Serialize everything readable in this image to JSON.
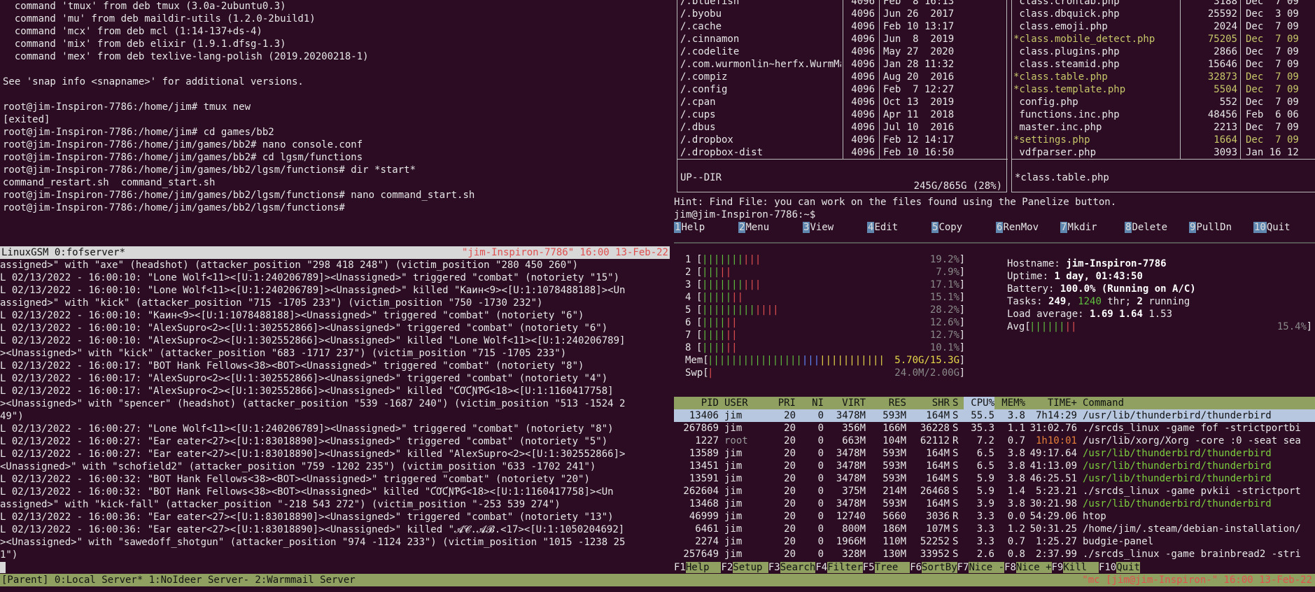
{
  "terminal_top_left": {
    "lines": [
      "  command 'tmux' from deb tmux (3.0a-2ubuntu0.3)",
      "  command 'mu' from deb maildir-utils (1.2.0-2build1)",
      "  command 'mcx' from deb mcl (1:14-137+ds-4)",
      "  command 'mix' from deb elixir (1.9.1.dfsg-1.3)",
      "  command 'mex' from deb texlive-lang-polish (2019.20200218-1)",
      "",
      "See 'snap info <snapname>' for additional versions.",
      "",
      "root@jim-Inspiron-7786:/home/jim# tmux new",
      "[exited]",
      "root@jim-Inspiron-7786:/home/jim# cd games/bb2",
      "root@jim-Inspiron-7786:/home/jim/games/bb2# nano console.conf",
      "root@jim-Inspiron-7786:/home/jim/games/bb2# cd lgsm/functions",
      "root@jim-Inspiron-7786:/home/jim/games/bb2/lgsm/functions# dir *start*",
      "command_restart.sh  command_start.sh",
      "root@jim-Inspiron-7786:/home/jim/games/bb2/lgsm/functions# nano command_start.sh",
      "root@jim-Inspiron-7786:/home/jim/games/bb2/lgsm/functions#"
    ]
  },
  "tmux_pane_status": {
    "left": "LinuxGSM 0:fofserver*",
    "right": "\"jim-Inspiron-7786\" 16:00 13-Feb-22"
  },
  "terminal_bottom_left": {
    "lines": [
      "assigned>\" with \"axe\" (headshot) (attacker_position \"298 418 248\") (victim_position \"280 450 260\")",
      "L 02/13/2022 - 16:00:10: \"Lone Wolf<11><[U:1:240206789]><Unassigned>\" triggered \"combat\" (notoriety \"15\")",
      "L 02/13/2022 - 16:00:10: \"Lone Wolf<11><[U:1:240206789]><Unassigned>\" killed \"Каин<9><[U:1:1078488188]><Un",
      "assigned>\" with \"kick\" (attacker_position \"715 -1705 233\") (victim_position \"750 -1730 232\")",
      "L 02/13/2022 - 16:00:10: \"Каин<9><[U:1:1078488188]><Unassigned>\" triggered \"combat\" (notoriety \"6\")",
      "L 02/13/2022 - 16:00:10: \"AlexSupro<2><[U:1:302552866]><Unassigned>\" triggered \"combat\" (notoriety \"6\")",
      "L 02/13/2022 - 16:00:10: \"AlexSupro<2><[U:1:302552866]><Unassigned>\" killed \"Lone Wolf<11><[U:1:240206789]",
      "><Unassigned>\" with \"kick\" (attacker_position \"683 -1717 237\") (victim_position \"715 -1705 233\")",
      "L 02/13/2022 - 16:00:17: \"BOT Hank Fellows<38><BOT><Unassigned>\" triggered \"combat\" (notoriety \"8\")",
      "L 02/13/2022 - 16:00:17: \"AlexSupro<2><[U:1:302552866]><Unassigned>\" triggered \"combat\" (notoriety \"4\")",
      "L 02/13/2022 - 16:00:17: \"AlexSupro<2><[U:1:302552866]><Unassigned>\" killed \"ƇƠƇƝƤƓ<18><[U:1:1160417758]",
      "><Unassigned>\" with \"spencer\" (headshot) (attacker_position \"539 -1687 240\") (victim_position \"513 -1524 2",
      "49\")",
      "L 02/13/2022 - 16:00:27: \"Lone Wolf<11><[U:1:240206789]><Unassigned>\" triggered \"combat\" (notoriety \"8\")",
      "L 02/13/2022 - 16:00:27: \"Ear eater<27><[U:1:83018890]><Unassigned>\" triggered \"combat\" (notoriety \"5\")",
      "L 02/13/2022 - 16:00:27: \"Ear eater<27><[U:1:83018890]><Unassigned>\" killed \"AlexSupro<2><[U:1:302552866]>",
      "<Unassigned>\" with \"schofield2\" (attacker_position \"759 -1202 235\") (victim_position \"633 -1702 241\")",
      "L 02/13/2022 - 16:00:32: \"BOT Hank Fellows<38><BOT><Unassigned>\" triggered \"combat\" (notoriety \"20\")",
      "L 02/13/2022 - 16:00:32: \"BOT Hank Fellows<38><BOT><Unassigned>\" killed \"ƇƠƇƝƤƓ<18><[U:1:1160417758]><Un",
      "assigned>\" with \"kick-fall\" (attacker_position \"-218 543 272\") (victim_position \"-253 539 274\")",
      "L 02/13/2022 - 16:00:36: \"Ear eater<27><[U:1:83018890]><Unassigned>\" triggered \"combat\" (notoriety \"13\")",
      "L 02/13/2022 - 16:00:36: \"Ear eater<27><[U:1:83018890]><Unassigned>\" killed \"𝓐𝓒.𝓐𝓑.<17><[U:1:1050204692]",
      "><Unassigned>\" with \"sawedoff_shotgun\" (attacker_position \"974 -1124 233\") (victim_position \"1015 -1238 25",
      "1\")"
    ]
  },
  "mc": {
    "left_panel": {
      "rows": [
        {
          "name": "/.bluefish",
          "size": "4096",
          "date": "Feb  8 16:13"
        },
        {
          "name": "/.byobu",
          "size": "4096",
          "date": "Jun 26  2017"
        },
        {
          "name": "/.cache",
          "size": "4096",
          "date": "Feb 10 13:17"
        },
        {
          "name": "/.cinnamon",
          "size": "4096",
          "date": "Jun  8  2019"
        },
        {
          "name": "/.codelite",
          "size": "4096",
          "date": "May 27  2020"
        },
        {
          "name": "/.com.wurmonlin~herfx.WurmMain",
          "size": "4096",
          "date": "Jan 28 11:32"
        },
        {
          "name": "/.compiz",
          "size": "4096",
          "date": "Aug 20  2016"
        },
        {
          "name": "/.config",
          "size": "4096",
          "date": "Feb  7 12:27"
        },
        {
          "name": "/.cpan",
          "size": "4096",
          "date": "Oct 13  2019"
        },
        {
          "name": "/.cups",
          "size": "4096",
          "date": "Apr 11  2018"
        },
        {
          "name": "/.dbus",
          "size": "4096",
          "date": "Jul 10  2016"
        },
        {
          "name": "/.dropbox",
          "size": "4096",
          "date": "Feb 12 14:17"
        },
        {
          "name": "/.dropbox-dist",
          "size": "4096",
          "date": "Feb 10 16:50"
        }
      ],
      "status": "UP--DIR",
      "disk": "245G/865G (28%)"
    },
    "right_panel": {
      "rows": [
        {
          "name": " class.crontab.php",
          "size": "3188",
          "date": "Dec  7 09",
          "hl": false
        },
        {
          "name": " class.dbquick.php",
          "size": "25592",
          "date": "Dec  3 09",
          "hl": false
        },
        {
          "name": " class.emoji.php",
          "size": "2024",
          "date": "Dec  7 09",
          "hl": false
        },
        {
          "name": "*class.mobile_detect.php",
          "size": "75205",
          "date": "Dec  7 09",
          "hl": true
        },
        {
          "name": " class.plugins.php",
          "size": "2866",
          "date": "Dec  7 09",
          "hl": false
        },
        {
          "name": " class.steamid.php",
          "size": "15646",
          "date": "Dec  7 09",
          "hl": false
        },
        {
          "name": "*class.table.php",
          "size": "32873",
          "date": "Dec  7 09",
          "hl": true
        },
        {
          "name": "*class.template.php",
          "size": "5504",
          "date": "Dec  7 09",
          "hl": true
        },
        {
          "name": " config.php",
          "size": "552",
          "date": "Dec  7 09",
          "hl": false
        },
        {
          "name": " functions.inc.php",
          "size": "48456",
          "date": "Feb  6 06",
          "hl": false
        },
        {
          "name": " master.inc.php",
          "size": "2213",
          "date": "Dec  7 09",
          "hl": false
        },
        {
          "name": "*settings.php",
          "size": "1664",
          "date": "Dec  7 09",
          "hl": true
        },
        {
          "name": " vdfparser.php",
          "size": "3093",
          "date": "Jan 16 12",
          "hl": false
        }
      ],
      "status": "*class.table.php"
    },
    "hint": "Hint: Find File: you can work on the files found using the Panelize button.",
    "prompt": "jim@jim-Inspiron-7786:~$",
    "fkeys": [
      {
        "n": "1",
        "label": "Help"
      },
      {
        "n": "2",
        "label": "Menu"
      },
      {
        "n": "3",
        "label": "View"
      },
      {
        "n": "4",
        "label": "Edit"
      },
      {
        "n": "5",
        "label": "Copy"
      },
      {
        "n": "6",
        "label": "RenMov"
      },
      {
        "n": "7",
        "label": "Mkdir"
      },
      {
        "n": "8",
        "label": "Delete"
      },
      {
        "n": "9",
        "label": "PullDn"
      },
      {
        "n": "10",
        "label": "Quit"
      }
    ]
  },
  "htop": {
    "cpus": [
      {
        "id": "1",
        "pct": "19.2%",
        "bars": [
          [
            "g",
            7
          ],
          [
            "r",
            3
          ]
        ]
      },
      {
        "id": "2",
        "pct": "7.9%",
        "bars": [
          [
            "g",
            3
          ],
          [
            "r",
            2
          ]
        ]
      },
      {
        "id": "3",
        "pct": "17.1%",
        "bars": [
          [
            "g",
            7
          ],
          [
            "r",
            3
          ]
        ]
      },
      {
        "id": "4",
        "pct": "15.1%",
        "bars": [
          [
            "g",
            5
          ],
          [
            "r",
            2
          ]
        ]
      },
      {
        "id": "5",
        "pct": "28.2%",
        "bars": [
          [
            "g",
            9
          ],
          [
            "r",
            4
          ]
        ]
      },
      {
        "id": "6",
        "pct": "12.6%",
        "bars": [
          [
            "g",
            4
          ],
          [
            "r",
            2
          ]
        ]
      },
      {
        "id": "7",
        "pct": "12.7%",
        "bars": [
          [
            "g",
            4
          ],
          [
            "r",
            2
          ]
        ]
      },
      {
        "id": "8",
        "pct": "10.1%",
        "bars": [
          [
            "g",
            4
          ],
          [
            "r",
            2
          ]
        ]
      }
    ],
    "mem": {
      "label": "Mem",
      "value": "5.70G/15.3G"
    },
    "swp": {
      "label": "Swp",
      "value": "24.0M/2.00G"
    },
    "info": {
      "hostname_label": "Hostname: ",
      "hostname": "jim-Inspiron-7786",
      "uptime_label": "Uptime: ",
      "uptime": "1 day, 01:43:50",
      "battery_label": "Battery: ",
      "battery": "100.0% (Running on A/C)",
      "tasks_label": "Tasks: ",
      "tasks": "249",
      "thr": "1240",
      "thr_label": " thr; ",
      "running": "2",
      "running_label": " running",
      "load_label": "Load average: ",
      "load1": "1.69",
      "load5": "1.64",
      "load15": "1.53",
      "avg_label": "Avg",
      "avg_pct": "15.4%"
    },
    "columns": [
      "PID",
      "USER",
      "PRI",
      "NI",
      "VIRT",
      "RES",
      "SHR",
      "S",
      "CPU%",
      "MEM%",
      "TIME+",
      "Command"
    ],
    "processes": [
      {
        "pid": "13406",
        "user": "jim",
        "pri": "20",
        "ni": "0",
        "virt": "3478M",
        "res": "593M",
        "shr": "164M",
        "s": "S",
        "cpu": "55.5",
        "mem": "3.8",
        "time": "7h14:29",
        "cmd": "/usr/lib/thunderbird/thunderbird",
        "sel": true,
        "green": false
      },
      {
        "pid": "267869",
        "user": "jim",
        "pri": "20",
        "ni": "0",
        "virt": "356M",
        "res": "166M",
        "shr": "36228",
        "s": "S",
        "cpu": "35.3",
        "mem": "1.1",
        "time": "31:02.76",
        "cmd": "./srcds_linux -game fof -strictportbi",
        "sel": false,
        "green": false
      },
      {
        "pid": "1227",
        "user": "root",
        "pri": "20",
        "ni": "0",
        "virt": "663M",
        "res": "104M",
        "shr": "62112",
        "s": "R",
        "cpu": "7.2",
        "mem": "0.7",
        "time": "1h10:01",
        "cmd": "/usr/lib/xorg/Xorg -core :0 -seat sea",
        "sel": false,
        "green": false
      },
      {
        "pid": "13589",
        "user": "jim",
        "pri": "20",
        "ni": "0",
        "virt": "3478M",
        "res": "593M",
        "shr": "164M",
        "s": "S",
        "cpu": "6.5",
        "mem": "3.8",
        "time": "49:17.64",
        "cmd": "/usr/lib/thunderbird/thunderbird",
        "sel": false,
        "green": true
      },
      {
        "pid": "13451",
        "user": "jim",
        "pri": "20",
        "ni": "0",
        "virt": "3478M",
        "res": "593M",
        "shr": "164M",
        "s": "S",
        "cpu": "6.5",
        "mem": "3.8",
        "time": "41:13.09",
        "cmd": "/usr/lib/thunderbird/thunderbird",
        "sel": false,
        "green": true
      },
      {
        "pid": "13591",
        "user": "jim",
        "pri": "20",
        "ni": "0",
        "virt": "3478M",
        "res": "593M",
        "shr": "164M",
        "s": "S",
        "cpu": "5.9",
        "mem": "3.8",
        "time": "46:25.51",
        "cmd": "/usr/lib/thunderbird/thunderbird",
        "sel": false,
        "green": true
      },
      {
        "pid": "262604",
        "user": "jim",
        "pri": "20",
        "ni": "0",
        "virt": "375M",
        "res": "214M",
        "shr": "26468",
        "s": "S",
        "cpu": "5.9",
        "mem": "1.4",
        "time": "5:23.21",
        "cmd": "./srcds_linux -game pvkii -strictport",
        "sel": false,
        "green": false
      },
      {
        "pid": "13468",
        "user": "jim",
        "pri": "20",
        "ni": "0",
        "virt": "3478M",
        "res": "593M",
        "shr": "164M",
        "s": "S",
        "cpu": "3.9",
        "mem": "3.8",
        "time": "30:21.98",
        "cmd": "/usr/lib/thunderbird/thunderbird",
        "sel": false,
        "green": true
      },
      {
        "pid": "46999",
        "user": "jim",
        "pri": "20",
        "ni": "0",
        "virt": "12740",
        "res": "5660",
        "shr": "3036",
        "s": "R",
        "cpu": "3.3",
        "mem": "0.0",
        "time": "54:29.06",
        "cmd": "htop",
        "sel": false,
        "green": false
      },
      {
        "pid": "6461",
        "user": "jim",
        "pri": "20",
        "ni": "0",
        "virt": "800M",
        "res": "186M",
        "shr": "107M",
        "s": "S",
        "cpu": "3.3",
        "mem": "1.2",
        "time": "50:31.25",
        "cmd": "/home/jim/.steam/debian-installation/",
        "sel": false,
        "green": false
      },
      {
        "pid": "2274",
        "user": "jim",
        "pri": "20",
        "ni": "0",
        "virt": "1966M",
        "res": "110M",
        "shr": "52252",
        "s": "S",
        "cpu": "3.3",
        "mem": "0.7",
        "time": "1:25.27",
        "cmd": "budgie-panel",
        "sel": false,
        "green": false
      },
      {
        "pid": "257649",
        "user": "jim",
        "pri": "20",
        "ni": "0",
        "virt": "328M",
        "res": "130M",
        "shr": "33952",
        "s": "S",
        "cpu": "2.6",
        "mem": "0.8",
        "time": "2:37.99",
        "cmd": "./srcds_linux -game brainbread2 -stri",
        "sel": false,
        "green": false
      }
    ],
    "fkeys": [
      {
        "k": "F1",
        "label": "Help  "
      },
      {
        "k": "F2",
        "label": "Setup "
      },
      {
        "k": "F3",
        "label": "Search"
      },
      {
        "k": "F4",
        "label": "Filter"
      },
      {
        "k": "F5",
        "label": "Tree  "
      },
      {
        "k": "F6",
        "label": "SortBy"
      },
      {
        "k": "F7",
        "label": "Nice -"
      },
      {
        "k": "F8",
        "label": "Nice +"
      },
      {
        "k": "F9",
        "label": "Kill  "
      },
      {
        "k": "F10",
        "label": "Quit"
      }
    ]
  },
  "tmux_status": {
    "left": "[Parent] 0:Local Server* 1:NoIdeer Server- 2:Warmmail Server",
    "right": "\"mc [jim@jim-Inspiron-\" 16:00 13-Feb-22"
  },
  "colors": {
    "background": "#2b0c22",
    "status_bar": "#8fa060",
    "selection": "#b7c7e0",
    "highlight_file": "#c7c76a"
  }
}
